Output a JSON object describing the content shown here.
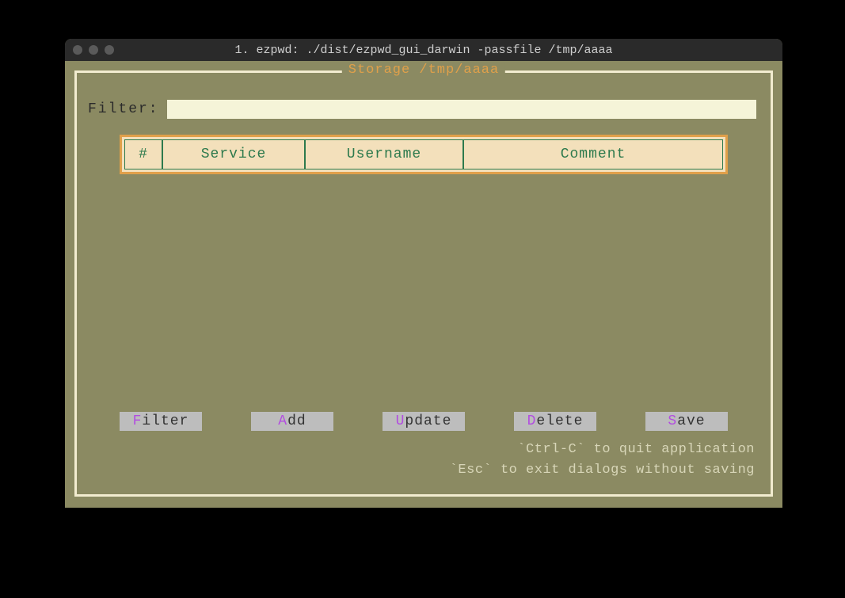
{
  "titlebar": {
    "title": "1. ezpwd: ./dist/ezpwd_gui_darwin -passfile /tmp/aaaa"
  },
  "storage": {
    "title": "Storage /tmp/aaaa"
  },
  "filter": {
    "label": "Filter:",
    "value": ""
  },
  "table": {
    "headers": {
      "index": "#",
      "service": "Service",
      "username": "Username",
      "comment": "Comment"
    }
  },
  "buttons": {
    "filter": {
      "hotkey": "F",
      "rest": "ilter"
    },
    "add": {
      "hotkey": "A",
      "rest": "dd"
    },
    "update": {
      "hotkey": "U",
      "rest": "pdate"
    },
    "delete": {
      "hotkey": "D",
      "rest": "elete"
    },
    "save": {
      "hotkey": "S",
      "rest": "ave"
    }
  },
  "hints": {
    "line1": "`Ctrl-C` to quit application",
    "line2": "`Esc` to exit dialogs without saving"
  }
}
